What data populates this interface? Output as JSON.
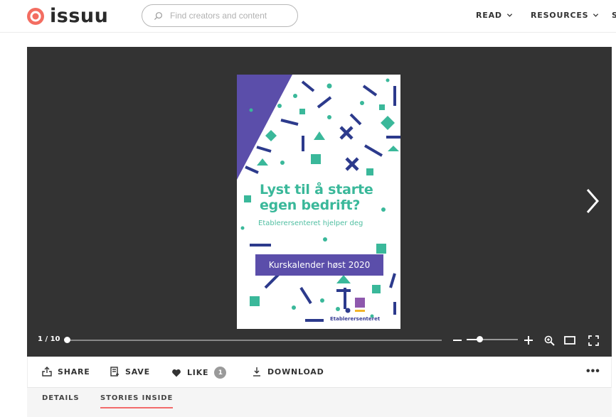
{
  "header": {
    "logo_text": "issuu",
    "search": {
      "placeholder": "Find creators and content"
    },
    "nav": [
      {
        "label": "READ"
      },
      {
        "label": "RESOURCES"
      },
      {
        "label": "S"
      }
    ]
  },
  "colors": {
    "brand": "#f36d61",
    "viewer_bg": "#333333",
    "cover_teal": "#3ab89a",
    "cover_purple": "#5b4eaa",
    "cover_navy": "#2c3a8c",
    "tab_underline": "#f26b6b"
  },
  "document": {
    "title_line1": "Lyst til å starte",
    "title_line2": "egen bedrift?",
    "subtitle": "Etablerersenteret hjelper deg",
    "badge": "Kurskalender høst 2020",
    "footer_logo_text": "Etablerersenteret"
  },
  "viewer": {
    "page_indicator": "1 / 10",
    "current_page": 1,
    "total_pages": 10,
    "zoom_level": 0.25,
    "icons": [
      "chevron-right-icon",
      "minus-icon",
      "plus-icon",
      "zoom-in-icon",
      "single-page-icon",
      "fullscreen-icon"
    ]
  },
  "actions": {
    "share": "SHARE",
    "save": "SAVE",
    "like": "LIKE",
    "like_count": "1",
    "download": "DOWNLOAD",
    "more": "•••"
  },
  "tabs": [
    {
      "label": "DETAILS",
      "active": false
    },
    {
      "label": "STORIES INSIDE",
      "active": true
    }
  ]
}
